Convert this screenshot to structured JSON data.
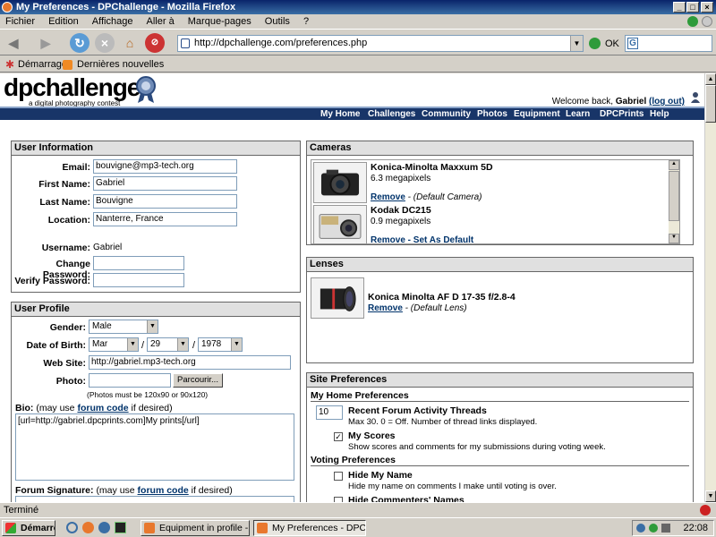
{
  "window": {
    "title": "My Preferences - DPChallenge - Mozilla Firefox"
  },
  "menu": [
    "Fichier",
    "Edition",
    "Affichage",
    "Aller à",
    "Marque-pages",
    "Outils",
    "?"
  ],
  "toolbar": {
    "url": "http://dpchallenge.com/preferences.php",
    "ok_label": "OK",
    "search_value": "G"
  },
  "bookmarks": [
    "Démarrage",
    "Dernières nouvelles"
  ],
  "site": {
    "logo": "dpchallenge",
    "tagline": "a digital photography contest",
    "welcome_prefix": "Welcome back,",
    "welcome_user": "Gabriel",
    "logout": "(log out)",
    "nav": [
      "My Home",
      "Challenges",
      "Community",
      "Photos",
      "Equipment",
      "Learn",
      "DPCPrints",
      "Help"
    ]
  },
  "user_info": {
    "title": "User Information",
    "email_label": "Email:",
    "email": "bouvigne@mp3-tech.org",
    "first_label": "First Name:",
    "first": "Gabriel",
    "last_label": "Last Name:",
    "last": "Bouvigne",
    "location_label": "Location:",
    "location": "Nanterre, France",
    "username_label": "Username:",
    "username": "Gabriel",
    "change_pw_label": "Change Password:",
    "verify_pw_label": "Verify Password:"
  },
  "user_profile": {
    "title": "User Profile",
    "gender_label": "Gender:",
    "gender": "Male",
    "dob_label": "Date of Birth:",
    "dob_month": "Mar",
    "dob_day": "29",
    "dob_year": "1978",
    "slash": "/",
    "website_label": "Web Site:",
    "website": "http://gabriel.mp3-tech.org",
    "photo_label": "Photo:",
    "browse": "Parcourir...",
    "photo_note": "(Photos must be 120x90 or 90x120)",
    "bio_label": "Bio:",
    "bio_note_prefix": "(may use",
    "bio_link": "forum code",
    "bio_note_suffix": "if desired)",
    "bio": "[url=http://gabriel.dpcprints.com]My prints[/url]",
    "sig_label": "Forum Signature:",
    "sig_note_prefix": "(may use",
    "sig_link": "forum code",
    "sig_note_suffix": "if desired)"
  },
  "cameras": {
    "title": "Cameras",
    "items": [
      {
        "name": "Konica-Minolta Maxxum 5D",
        "mp": "6.3 megapixels",
        "remove": "Remove",
        "note": " - (Default Camera)"
      },
      {
        "name": "Kodak DC215",
        "mp": "0.9 megapixels",
        "remove": "Remove",
        "note": " - Set As Default"
      }
    ]
  },
  "lenses": {
    "title": "Lenses",
    "items": [
      {
        "name": "Konica Minolta AF D 17-35 f/2.8-4",
        "remove": "Remove",
        "note": " - (Default Lens)"
      }
    ]
  },
  "site_prefs": {
    "title": "Site Preferences",
    "home_title": "My Home Preferences",
    "threads_value": "10",
    "threads_title": "Recent Forum Activity Threads",
    "threads_desc": "Max 30. 0 = Off. Number of thread links displayed.",
    "myscores_title": "My Scores",
    "myscores_desc": "Show scores and comments for my submissions during voting week.",
    "voting_title": "Voting Preferences",
    "hidename_title": "Hide My Name",
    "hidename_desc": "Hide my name on comments I make until voting is over.",
    "hidecomm_title": "Hide Commenters' Names"
  },
  "status": {
    "text": "Terminé"
  },
  "taskbar": {
    "start": "Démarrer",
    "tasks": [
      "Equipment in profile - DP...",
      "My Preferences - DPC..."
    ],
    "clock": "22:08"
  }
}
